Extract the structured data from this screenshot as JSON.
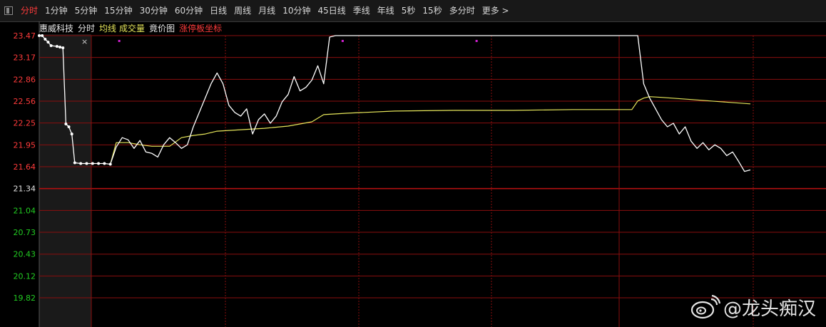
{
  "toolbar": {
    "tabs": [
      {
        "label": "分时",
        "active": true
      },
      {
        "label": "1分钟",
        "active": false
      },
      {
        "label": "5分钟",
        "active": false
      },
      {
        "label": "15分钟",
        "active": false
      },
      {
        "label": "30分钟",
        "active": false
      },
      {
        "label": "60分钟",
        "active": false
      },
      {
        "label": "日线",
        "active": false
      },
      {
        "label": "周线",
        "active": false
      },
      {
        "label": "月线",
        "active": false
      },
      {
        "label": "10分钟",
        "active": false
      },
      {
        "label": "45日线",
        "active": false
      },
      {
        "label": "季线",
        "active": false
      },
      {
        "label": "年线",
        "active": false
      },
      {
        "label": "5秒",
        "active": false
      },
      {
        "label": "15秒",
        "active": false
      },
      {
        "label": "多分时",
        "active": false
      },
      {
        "label": "更多 >",
        "active": false
      }
    ]
  },
  "header": {
    "stock_name": "惠威科技",
    "mode": "分时",
    "avg_line_label": "均线",
    "volume_label": "成交量",
    "auction_label": "竟价图",
    "limit_label": "涨停板坐标",
    "close_label": "×"
  },
  "colors": {
    "price_line": "#ffffff",
    "avg_line": "#e6e65a",
    "grid": "#8a0e0e",
    "up_label": "#ff3b3b",
    "down_label": "#22cc22",
    "marker": "#d020d0"
  },
  "watermark": {
    "text": "@龙头痴汉"
  },
  "chart_data": {
    "type": "line",
    "y_ticks": [
      "23.47",
      "23.17",
      "22.86",
      "22.56",
      "22.25",
      "21.95",
      "21.64",
      "21.34",
      "21.04",
      "20.73",
      "20.43",
      "20.12",
      "19.82"
    ],
    "ylim": [
      19.82,
      23.47
    ],
    "prev_close": 21.34,
    "series": [
      {
        "name": "",
        "points": [
          [
            0,
            23.47
          ],
          [
            0.5,
            23.47
          ],
          [
            1,
            23.42
          ],
          [
            1.5,
            23.38
          ],
          [
            2,
            23.33
          ],
          [
            3,
            23.32
          ],
          [
            3.5,
            23.31
          ],
          [
            4,
            23.3
          ],
          [
            4.5,
            22.24
          ],
          [
            5,
            22.2
          ],
          [
            5.5,
            22.1
          ],
          [
            6,
            21.7
          ],
          [
            7,
            21.69
          ],
          [
            8,
            21.69
          ],
          [
            9,
            21.69
          ],
          [
            10,
            21.69
          ],
          [
            11,
            21.69
          ],
          [
            12,
            21.68
          ],
          [
            13,
            21.92
          ],
          [
            14,
            22.05
          ],
          [
            15,
            22.02
          ],
          [
            16,
            21.9
          ],
          [
            17,
            22.01
          ],
          [
            18,
            21.85
          ],
          [
            19,
            21.83
          ],
          [
            20,
            21.78
          ],
          [
            21,
            21.95
          ],
          [
            22,
            22.05
          ],
          [
            23,
            21.98
          ],
          [
            24,
            21.9
          ],
          [
            25,
            21.95
          ],
          [
            26,
            22.2
          ],
          [
            27,
            22.4
          ],
          [
            28,
            22.6
          ],
          [
            29,
            22.8
          ],
          [
            30,
            22.95
          ],
          [
            31,
            22.8
          ],
          [
            32,
            22.5
          ],
          [
            33,
            22.4
          ],
          [
            34,
            22.35
          ],
          [
            35,
            22.45
          ],
          [
            36,
            22.1
          ],
          [
            37,
            22.3
          ],
          [
            38,
            22.38
          ],
          [
            39,
            22.25
          ],
          [
            40,
            22.35
          ],
          [
            41,
            22.55
          ],
          [
            42,
            22.65
          ],
          [
            43,
            22.9
          ],
          [
            44,
            22.7
          ],
          [
            45,
            22.75
          ],
          [
            46,
            22.85
          ],
          [
            47,
            23.05
          ],
          [
            48,
            22.8
          ],
          [
            49,
            23.45
          ],
          [
            50,
            23.47
          ],
          [
            100,
            23.47
          ],
          [
            101,
            23.47
          ],
          [
            102,
            22.8
          ],
          [
            103,
            22.6
          ],
          [
            104,
            22.45
          ],
          [
            105,
            22.3
          ],
          [
            106,
            22.2
          ],
          [
            107,
            22.25
          ],
          [
            108,
            22.1
          ],
          [
            109,
            22.2
          ],
          [
            110,
            22.0
          ],
          [
            111,
            21.9
          ],
          [
            112,
            21.98
          ],
          [
            113,
            21.88
          ],
          [
            114,
            21.95
          ],
          [
            115,
            21.9
          ],
          [
            116,
            21.8
          ],
          [
            117,
            21.85
          ],
          [
            118,
            21.72
          ],
          [
            119,
            21.58
          ],
          [
            120,
            21.6
          ]
        ]
      },
      {
        "name": "均线",
        "points": [
          [
            12,
            21.68
          ],
          [
            13,
            21.98
          ],
          [
            15,
            21.98
          ],
          [
            17,
            21.95
          ],
          [
            19,
            21.93
          ],
          [
            22,
            21.93
          ],
          [
            24,
            22.05
          ],
          [
            26,
            22.08
          ],
          [
            28,
            22.1
          ],
          [
            30,
            22.14
          ],
          [
            34,
            22.16
          ],
          [
            38,
            22.18
          ],
          [
            42,
            22.21
          ],
          [
            46,
            22.27
          ],
          [
            48,
            22.37
          ],
          [
            52,
            22.39
          ],
          [
            60,
            22.42
          ],
          [
            70,
            22.43
          ],
          [
            80,
            22.43
          ],
          [
            90,
            22.44
          ],
          [
            100,
            22.44
          ],
          [
            101,
            22.56
          ],
          [
            102,
            22.6
          ],
          [
            103,
            22.62
          ],
          [
            105,
            22.61
          ],
          [
            110,
            22.58
          ],
          [
            115,
            22.55
          ],
          [
            120,
            22.52
          ]
        ]
      }
    ],
    "markers_x": [
      13.5,
      51.2,
      73.8
    ]
  }
}
